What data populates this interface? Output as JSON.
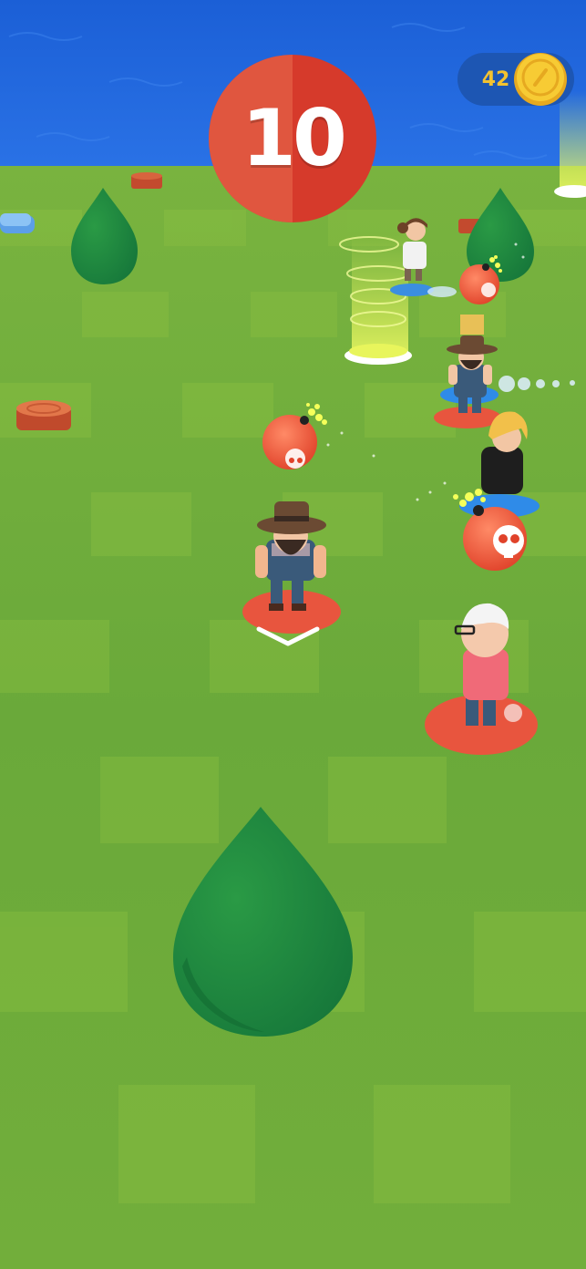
{
  "hud": {
    "timer": "10",
    "coins": "42"
  },
  "icons": {
    "coin": "coin-icon",
    "bomb": "skull-bomb-icon",
    "direction": "chevron-down-icon"
  },
  "colors": {
    "water": "#1f63d8",
    "grass_light": "#77b23f",
    "grass_dark": "#62a234",
    "timer_red": "#d63a2b",
    "coin_gold": "#f2c230",
    "tree_green": "#1f8a3a",
    "bomb_red": "#f05a3c"
  }
}
